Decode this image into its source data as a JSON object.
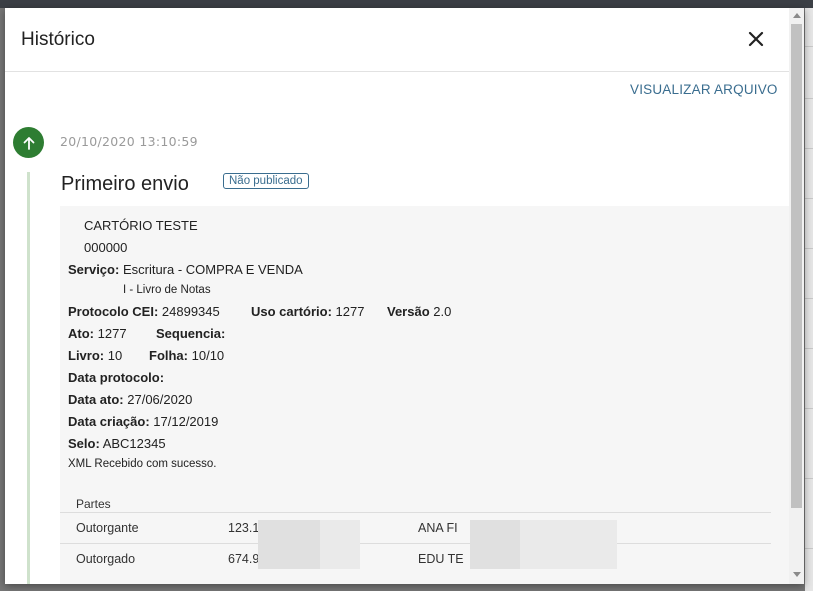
{
  "dialog": {
    "title": "Histórico",
    "close_icon": "close-icon",
    "view_file_label": "VISUALIZAR ARQUIVO"
  },
  "entry": {
    "timestamp": "20/10/2020 13:10:59",
    "title": "Primeiro envio",
    "status_badge": "Não publicado",
    "icon": "arrow-up-icon",
    "accent_color": "#2e7d32"
  },
  "details": {
    "office_name": "CARTÓRIO TESTE",
    "office_code": "000000",
    "servico_label": "Serviço:",
    "servico_value": "Escritura - COMPRA E VENDA",
    "livro_tipo": "I - Livro de Notas",
    "protocolo_cei_label": "Protocolo CEI:",
    "protocolo_cei_value": "24899345",
    "uso_cartorio_label": "Uso cartório:",
    "uso_cartorio_value": "1277",
    "versao_label": "Versão",
    "versao_value": "2.0",
    "ato_label": "Ato:",
    "ato_value": "1277",
    "sequencia_label": "Sequencia:",
    "livro_label": "Livro:",
    "livro_value": "10",
    "folha_label": "Folha:",
    "folha_value": "10/10",
    "data_protocolo_label": "Data protocolo:",
    "data_ato_label": "Data ato:",
    "data_ato_value": "27/06/2020",
    "data_criacao_label": "Data criação:",
    "data_criacao_value": "17/12/2019",
    "selo_label": "Selo:",
    "selo_value": "ABC12345",
    "xml_status": "XML Recebido com sucesso."
  },
  "parts": {
    "header": "Partes",
    "rows": [
      {
        "role": "Outorgante",
        "document": "123.1",
        "name": "ANA FI"
      },
      {
        "role": "Outorgado",
        "document": "674.9",
        "name": "EDU TE"
      }
    ]
  }
}
